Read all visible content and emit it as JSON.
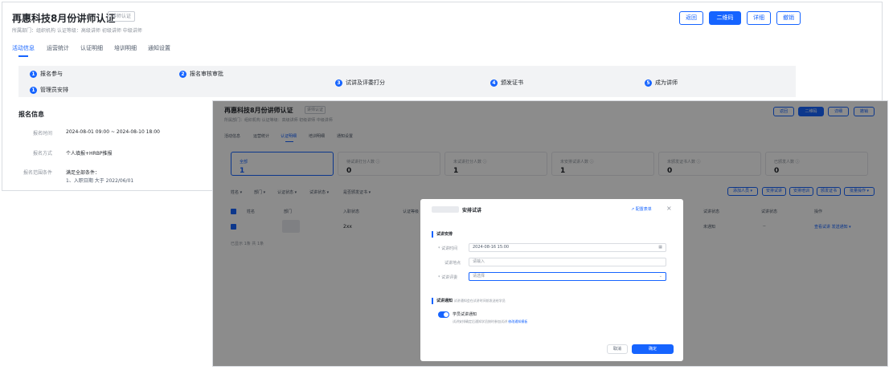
{
  "back": {
    "title": "再惠科技8月份讲师认证",
    "tag": "讲师认证",
    "meta": "所属部门：组织机构    认证等级：高级讲师 初级讲师 中级讲师",
    "buttons": [
      "返回",
      "二维码",
      "详细",
      "撤销"
    ],
    "tabs": [
      "活动信息",
      "运营统计",
      "认证明细",
      "培训明细",
      "通知设置"
    ],
    "steps": [
      "报名参与",
      "报名审核审批",
      "试讲及评委打分",
      "颁发证书",
      "成为讲师",
      "管理员安排"
    ],
    "step_nums": [
      "1",
      "2",
      "3",
      "4",
      "5",
      "1"
    ],
    "section": "报名信息",
    "rows": [
      {
        "label": "报名时间",
        "value": "2024-08-01 09:00 ~ 2024-08-10 18:00"
      },
      {
        "label": "报名方式",
        "value": "个人填报+HRBP推报"
      },
      {
        "label": "报名范围条件",
        "value": "满足全部条件：",
        "extra": "1、入职日期 大于 2022/06/01"
      }
    ]
  },
  "front": {
    "title": "再惠科技8月份讲师认证",
    "tag": "讲师认证",
    "meta": "所属部门：组织机构    认证等级：高级讲师 初级讲师 中级讲师",
    "buttons": [
      "返回",
      "二维码",
      "详细",
      "撤销"
    ],
    "tabs": [
      "活动信息",
      "运营统计",
      "认证明细",
      "培训明细",
      "通知设置"
    ],
    "cards": [
      {
        "title": "全部",
        "value": "1"
      },
      {
        "title": "待试讲打分人数 ⓘ",
        "value": "0"
      },
      {
        "title": "未试讲打分人数 ⓘ",
        "value": "1"
      },
      {
        "title": "未安排试讲人数 ⓘ",
        "value": "1"
      },
      {
        "title": "未颁发证书人数 ⓘ",
        "value": "0"
      },
      {
        "title": "已颁发人数 ⓘ",
        "value": "0"
      }
    ],
    "filters": [
      "姓名 ▾",
      "部门 ▾",
      "认证状态 ▾",
      "试讲状态 ▾",
      "是否颁发证书 ▾"
    ],
    "actions": [
      "添加人员 ▾",
      "安排试讲",
      "安排培训",
      "颁发证书",
      "批量操作 ▾"
    ],
    "table_headers": [
      "姓名",
      "部门",
      "入职状态",
      "认证等级",
      "试讲状态",
      "试讲状态",
      "操作"
    ],
    "row": {
      "status": "2xx",
      "state": "未通知",
      "dash": "--",
      "ops": "查看试讲  发送通知 ▾"
    },
    "footer": "已显示 1条 共 1条"
  },
  "modal": {
    "title_suffix": "安排试讲",
    "config_link": "配置表单",
    "section1": "试讲安排",
    "fields": [
      {
        "label": "* 试讲时间",
        "value": "2024-08-16 15:00",
        "icon": "calendar-icon"
      },
      {
        "label": "试讲地点",
        "value": "请输入"
      },
      {
        "label": "* 试讲评委",
        "value": "请选择"
      }
    ],
    "section2": "试讲通知",
    "section2_hint": "试讲通知会在试讲时间前发送给学员",
    "toggle_label": "学员试讲通知",
    "toggle_hint": "试讲安排确定后通知学员按时参加试讲",
    "toggle_link": "修改通知模板",
    "cancel": "取消",
    "confirm": "确定"
  }
}
